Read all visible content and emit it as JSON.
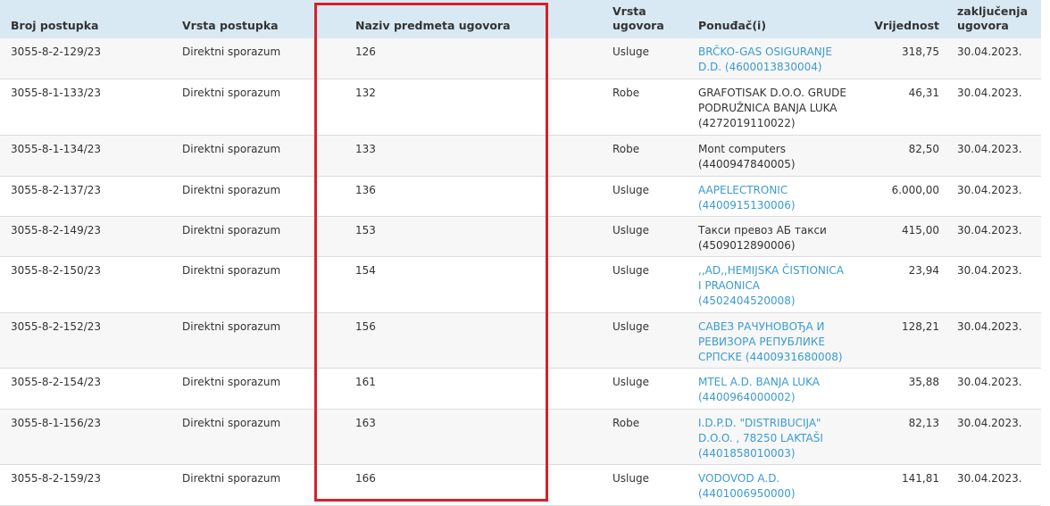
{
  "table": {
    "headers": [
      "Broj postupka",
      "Vrsta postupka",
      "Naziv predmeta ugovora",
      "Vrsta ugovora",
      "Ponuđač(i)",
      "Vrijednost",
      "zaključenja ugovora"
    ],
    "rows": [
      {
        "broj": "3055-8-2-129/23",
        "vrsta_postupka": "Direktni sporazum",
        "naziv": "126",
        "vrsta_ugovora": "Usluge",
        "ponudjac": "BRČKO-GAS OSIGURANJE D.D. (4600013830004)",
        "ponudjac_link": true,
        "vrijednost": "318,75",
        "datum": "30.04.2023."
      },
      {
        "broj": "3055-8-1-133/23",
        "vrsta_postupka": "Direktni sporazum",
        "naziv": "132",
        "vrsta_ugovora": "Robe",
        "ponudjac": "GRAFOTISAK D.O.O. GRUDE PODRUŽNICA BANJA LUKA (4272019110022)",
        "ponudjac_link": false,
        "vrijednost": "46,31",
        "datum": "30.04.2023."
      },
      {
        "broj": "3055-8-1-134/23",
        "vrsta_postupka": "Direktni sporazum",
        "naziv": "133",
        "vrsta_ugovora": "Robe",
        "ponudjac": "Mont computers (4400947840005)",
        "ponudjac_link": false,
        "vrijednost": "82,50",
        "datum": "30.04.2023."
      },
      {
        "broj": "3055-8-2-137/23",
        "vrsta_postupka": "Direktni sporazum",
        "naziv": "136",
        "vrsta_ugovora": "Usluge",
        "ponudjac": "AAPELECTRONIC (4400915130006)",
        "ponudjac_link": true,
        "vrijednost": "6.000,00",
        "datum": "30.04.2023."
      },
      {
        "broj": "3055-8-2-149/23",
        "vrsta_postupka": "Direktni sporazum",
        "naziv": "153",
        "vrsta_ugovora": "Usluge",
        "ponudjac": "Такси превоз АБ такси (4509012890006)",
        "ponudjac_link": false,
        "vrijednost": "415,00",
        "datum": "30.04.2023."
      },
      {
        "broj": "3055-8-2-150/23",
        "vrsta_postupka": "Direktni sporazum",
        "naziv": "154",
        "vrsta_ugovora": "Usluge",
        "ponudjac": ",,AD,,HEMIJSKA ČISTIONICA I PRAONICA (4502404520008)",
        "ponudjac_link": true,
        "vrijednost": "23,94",
        "datum": "30.04.2023."
      },
      {
        "broj": "3055-8-2-152/23",
        "vrsta_postupka": "Direktni sporazum",
        "naziv": "156",
        "vrsta_ugovora": "Usluge",
        "ponudjac": "САВЕЗ РАЧУНОВОЂА И РЕВИЗОРА РЕПУБЛИКЕ СРПСКЕ (4400931680008)",
        "ponudjac_link": true,
        "vrijednost": "128,21",
        "datum": "30.04.2023."
      },
      {
        "broj": "3055-8-2-154/23",
        "vrsta_postupka": "Direktni sporazum",
        "naziv": "161",
        "vrsta_ugovora": "Usluge",
        "ponudjac": "MTEL A.D. BANJA LUKA (4400964000002)",
        "ponudjac_link": true,
        "vrijednost": "35,88",
        "datum": "30.04.2023."
      },
      {
        "broj": "3055-8-1-156/23",
        "vrsta_postupka": "Direktni sporazum",
        "naziv": "163",
        "vrsta_ugovora": "Robe",
        "ponudjac": "I.D.P.D. \"DISTRIBUCIJA\" D.O.O. , 78250 LAKTAŠI (4401858010003)",
        "ponudjac_link": true,
        "vrijednost": "82,13",
        "datum": "30.04.2023."
      },
      {
        "broj": "3055-8-2-159/23",
        "vrsta_postupka": "Direktni sporazum",
        "naziv": "166",
        "vrsta_ugovora": "Usluge",
        "ponudjac": "VODOVOD A.D. (4401006950000)",
        "ponudjac_link": true,
        "vrijednost": "141,81",
        "datum": "30.04.2023."
      }
    ]
  },
  "colors": {
    "header_bg": "#d9e9f3",
    "link": "#3a9bd0",
    "highlight": "#d6202a",
    "row_alt": "#f7f7f7"
  }
}
